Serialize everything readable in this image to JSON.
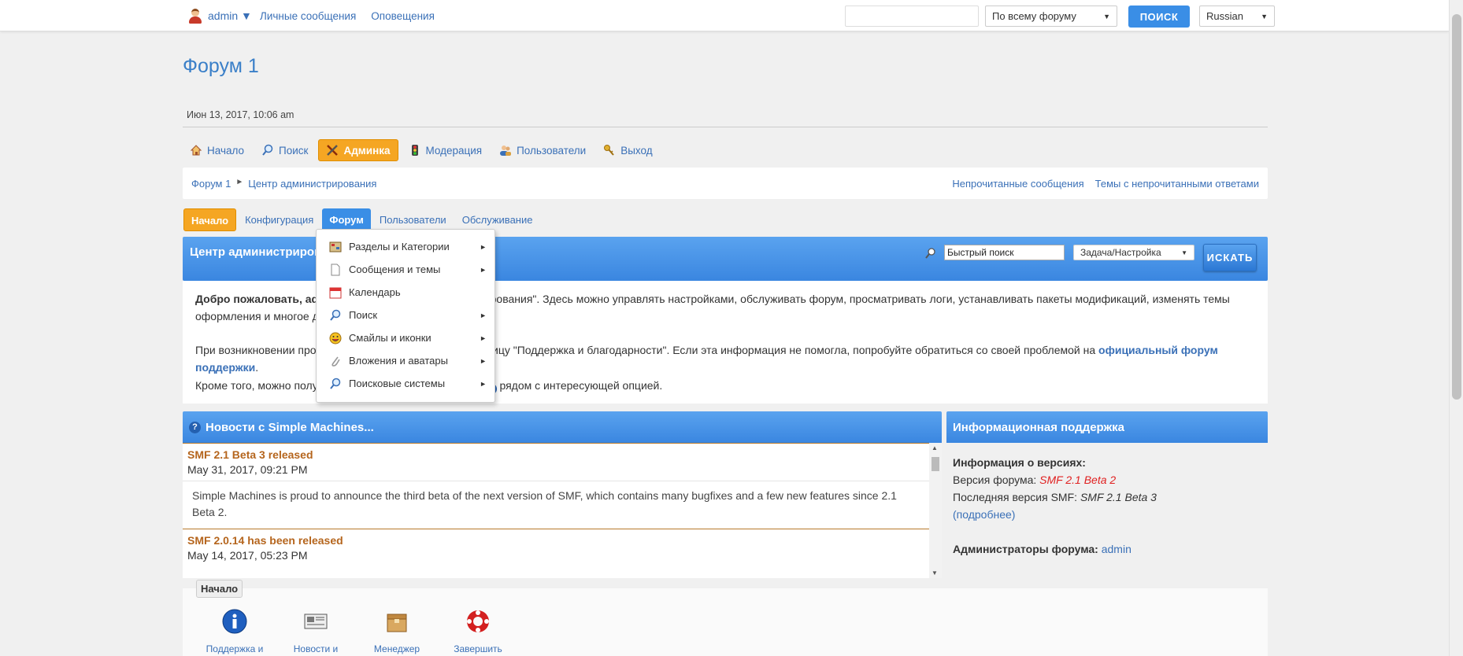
{
  "topbar": {
    "username": "admin ▼",
    "links": [
      "Личные сообщения",
      "Оповещения"
    ],
    "search_value": "",
    "search_scope": "По всему форуму",
    "search_button": "ПОИСК",
    "language": "Russian"
  },
  "forum_title": "Форум 1",
  "date_line": "Июн 13, 2017, 10:06 am",
  "main_menu": [
    {
      "label": "Начало",
      "icon": "home-icon"
    },
    {
      "label": "Поиск",
      "icon": "search-icon"
    },
    {
      "label": "Админка",
      "icon": "tools-icon",
      "active": true
    },
    {
      "label": "Модерация",
      "icon": "traffic-light-icon"
    },
    {
      "label": "Пользователи",
      "icon": "users-icon"
    },
    {
      "label": "Выход",
      "icon": "key-icon"
    }
  ],
  "breadcrumb": {
    "items": [
      "Форум 1",
      "Центр администрирования"
    ],
    "separator": "►",
    "right_links": [
      "Непрочитанные сообщения",
      "Темы с непрочитанными ответами"
    ]
  },
  "admin_tabs": [
    "Начало",
    "Конфигурация",
    "Форум",
    "Пользователи",
    "Обслуживание"
  ],
  "admin_header": {
    "title": "Центр администрирования",
    "quick_search_value": "Быстрый поиск",
    "task_select": "Задача/Настройка",
    "search_button": "ИСКАТЬ"
  },
  "admin_body": {
    "welcome_bold": "Добро пожаловать, admin!",
    "welcome_rest": " Это ваш \"Центр администрирования\". Здесь можно управлять настройками, обслуживать форум, просматривать логи, устанавливать пакеты модификаций, изменять темы оформления и многое другое.",
    "help_text": "При возникновении проблем, пожалуйста, посетите страницу \"Поддержка и благодарности\". Если эта информация не помогла, попробуйте обратиться со своей проблемой на ",
    "help_link": "официальный форум поддержки",
    "help_end": ".",
    "also_text_start": "Кроме того, можно получить помощь, кликнув по значку ",
    "also_text_end": " рядом с интересующей опцией."
  },
  "news": {
    "title": "Новости с Simple Machines...",
    "items": [
      {
        "subject": "SMF 2.1 Beta 3 released",
        "date": "May 31, 2017, 09:21 PM",
        "text": "Simple Machines is proud to announce the third beta of the next version of SMF, which contains many bugfixes and a few new features since 2.1 Beta 2."
      },
      {
        "subject": "SMF 2.0.14 has been released",
        "date": "May 14, 2017, 05:23 PM"
      }
    ]
  },
  "support": {
    "title": "Информационная поддержка",
    "versions_label": "Информация о версиях:",
    "forum_version_label": "Версия форума: ",
    "forum_version": "SMF 2.1 Beta 2",
    "latest_version_label": "Последняя версия SMF: ",
    "latest_version": "SMF 2.1 Beta 3",
    "details_link": "(подробнее)",
    "admins_label": "Администраторы форума:",
    "admin_name": "admin"
  },
  "start_section": {
    "legend": "Начало",
    "icons": [
      {
        "label": "Поддержка и благодарности",
        "icon": "info-icon"
      },
      {
        "label": "Новости и рассылка",
        "icon": "newspaper-icon"
      },
      {
        "label": "Менеджер пакетов",
        "icon": "package-icon"
      },
      {
        "label": "Завершить сессию",
        "icon": "lifebuoy-icon"
      }
    ]
  },
  "dropdown": {
    "items": [
      {
        "label": "Разделы и Категории",
        "icon": "boards-icon",
        "submenu": true
      },
      {
        "label": "Сообщения и темы",
        "icon": "posts-icon",
        "submenu": true
      },
      {
        "label": "Календарь",
        "icon": "calendar-icon",
        "submenu": false
      },
      {
        "label": "Поиск",
        "icon": "search-icon",
        "submenu": true
      },
      {
        "label": "Смайлы и иконки",
        "icon": "smiley-icon",
        "submenu": true
      },
      {
        "label": "Вложения и аватары",
        "icon": "paperclip-icon",
        "submenu": true
      },
      {
        "label": "Поисковые системы",
        "icon": "search-engine-icon",
        "submenu": true
      }
    ],
    "arrow": "►"
  },
  "colors": {
    "accent": "#3a8ee6",
    "active_orange": "#f5a623",
    "link": "#3a70b7",
    "news_subject": "#b5651d"
  }
}
